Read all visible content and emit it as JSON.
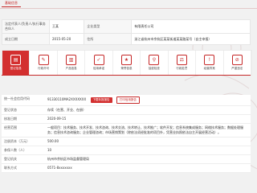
{
  "breadcrumb": "基础信息",
  "info": {
    "rows": [
      {
        "l1": "法定代表人/负责人/执行事务合伙人",
        "v1": "王某",
        "l2": "企业类型",
        "v2": "有限责任公司"
      },
      {
        "l1": "成立日期",
        "v1": "2015-05-20",
        "l2": "住所",
        "v2": "浙江省杭州市余杭区某某街道某某路某号（自主申报）"
      }
    ]
  },
  "tabs": [
    {
      "label": "登记信息",
      "icon": "▤"
    },
    {
      "label": "行政许可",
      "icon": "✎"
    },
    {
      "label": "产品信息",
      "icon": "▥"
    },
    {
      "label": "信用承诺",
      "icon": "✓"
    },
    {
      "label": "荣誉信息",
      "icon": "★"
    },
    {
      "label": "抽查检查",
      "icon": "⚲"
    },
    {
      "label": "行政处罚",
      "icon": "⚖"
    },
    {
      "label": "经营异常",
      "icon": "!"
    },
    {
      "label": "严重违法",
      "icon": "⊘"
    }
  ],
  "detail": {
    "credit_code_label": "统一社会信用代码",
    "credit_code": "91330110MA2XXXXXXX",
    "btn_report": "下载年报报告",
    "btn_print": "打印信用报告",
    "status_label": "登记状态",
    "status": "存续（在营、开业、在册）",
    "date_label": "核准日期",
    "date": "2020-09-15",
    "scope_label": "经营范围",
    "scope": "一般项目：技术服务、技术开发、技术咨询、技术交流、技术转让、技术推广；软件开发；信息系统集成服务；网络技术服务；数据处理服务；信息技术咨询服务；企业管理咨询；市场营销策划（除依法须经批准的项目外，凭营业执照依法自主开展经营活动）。",
    "capital_label": "注册资本（万元）",
    "capital": "500.00",
    "insured_label": "参保人数（人）",
    "insured": "10",
    "insured2_label": "登记机关",
    "insured2": "杭州市余杭区市场监督管理局",
    "footer_label": "联系方式",
    "footer": "0571-8xxxxxxx"
  }
}
